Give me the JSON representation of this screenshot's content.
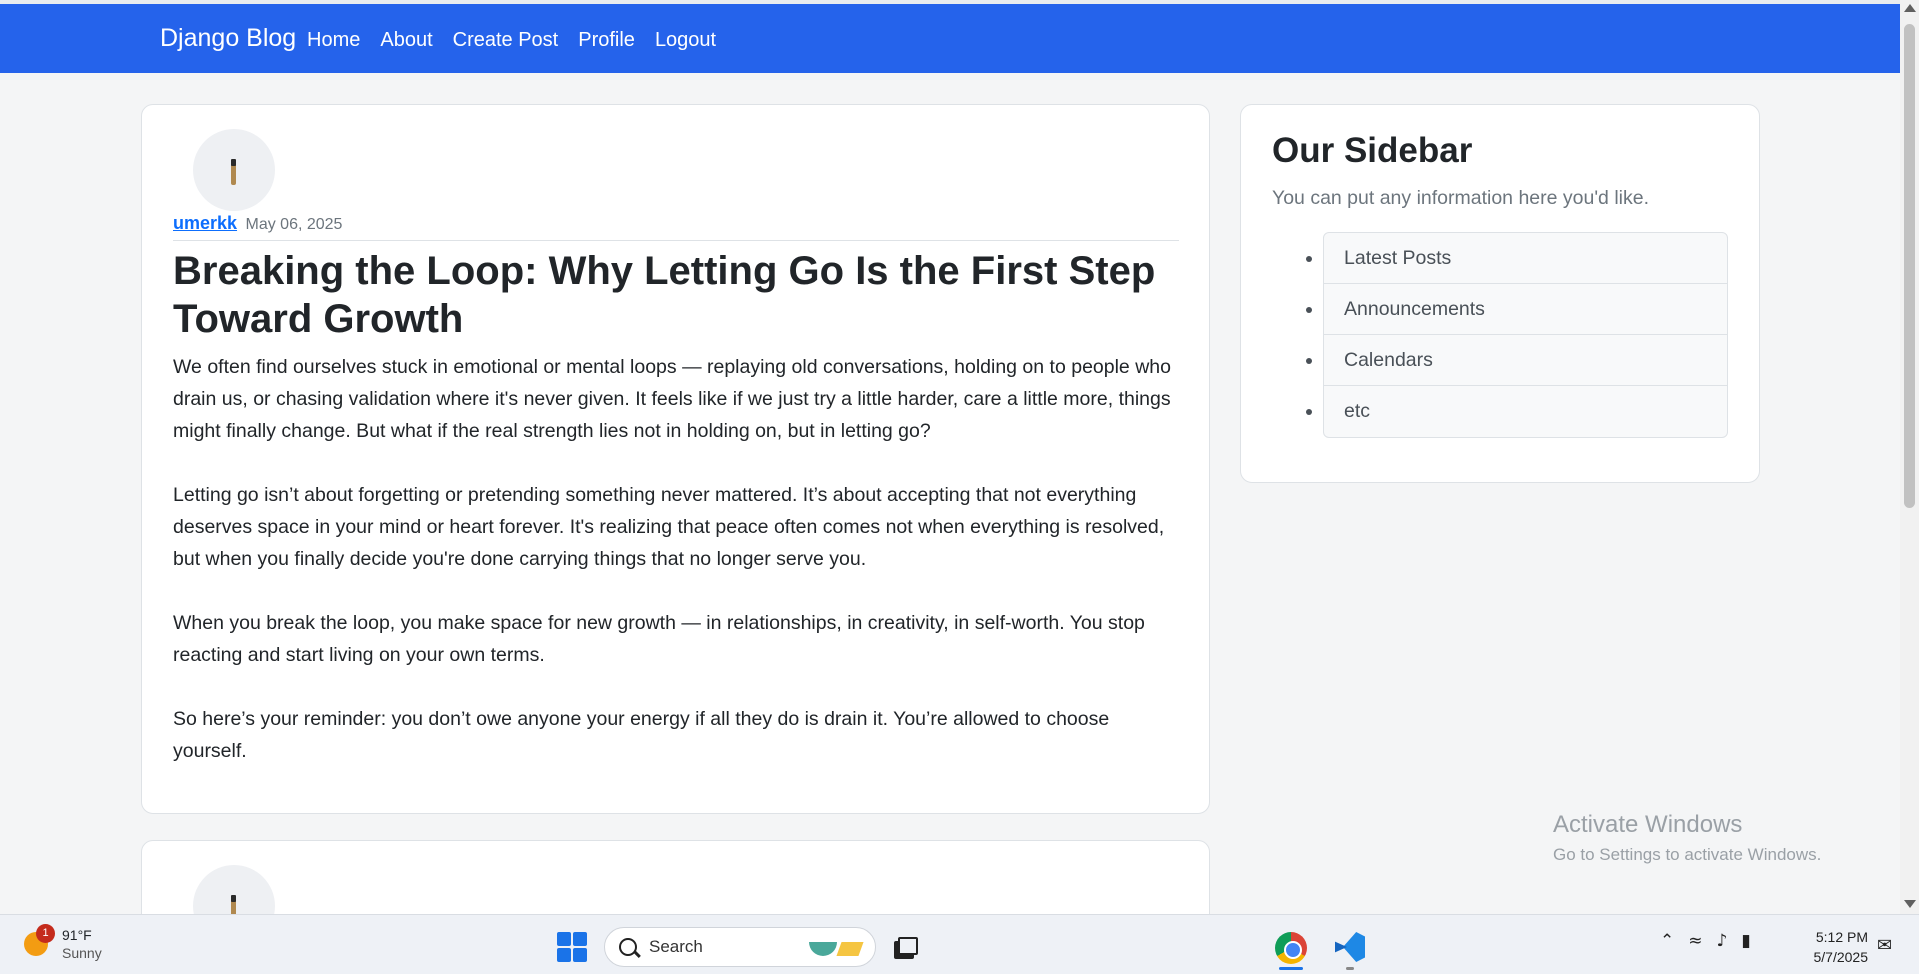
{
  "navbar": {
    "brand": "Django Blog",
    "links": [
      "Home",
      "About",
      "Create Post",
      "Profile",
      "Logout"
    ]
  },
  "post": {
    "author": "umerkk",
    "date": "May 06, 2025",
    "title": "Breaking the Loop: Why Letting Go Is the First Step Toward Growth",
    "paragraphs": [
      "We often find ourselves stuck in emotional or mental loops — replaying old conversations, holding on to people who drain us, or chasing validation where it's never given. It feels like if we just try a little harder, care a little more, things might finally change. But what if the real strength lies not in holding on, but in letting go?",
      "Letting go isn’t about forgetting or pretending something never mattered. It’s about accepting that not everything deserves space in your mind or heart forever. It's realizing that peace often comes not when everything is resolved, but when you finally decide you're done carrying things that no longer serve you.",
      "When you break the loop, you make space for new growth — in relationships, in creativity, in self-worth. You stop reacting and start living on your own terms.",
      "So here’s your reminder: you don’t owe anyone your energy if all they do is drain it. You’re allowed to choose yourself."
    ]
  },
  "sidebar": {
    "title": "Our Sidebar",
    "text": "You can put any information here you'd like.",
    "items": [
      "Latest Posts",
      "Announcements",
      "Calendars",
      "etc"
    ]
  },
  "watermark": {
    "line1": "Activate Windows",
    "line2": "Go to Settings to activate Windows."
  },
  "taskbar": {
    "weather_badge": "1",
    "temperature": "91°F",
    "condition": "Sunny",
    "search_placeholder": "Search",
    "time": "5:12 PM",
    "date": "5/7/2025"
  },
  "colors": {
    "navbar": "#2563eb",
    "link": "#0d6efd"
  }
}
